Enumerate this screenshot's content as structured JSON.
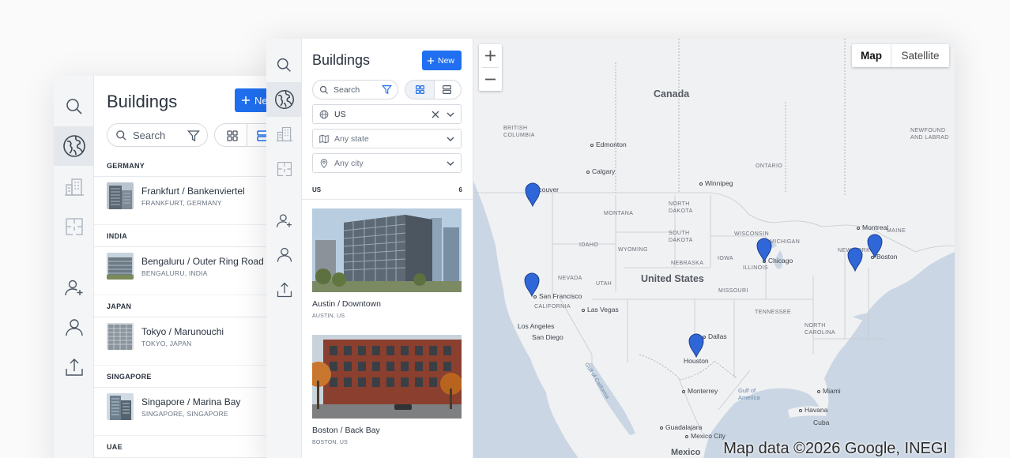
{
  "colors": {
    "accent": "#1f6ff0",
    "marker": "#2f66d8",
    "land": "#f0f1f3",
    "water": "#cad6e3"
  },
  "back_window": {
    "title": "Buildings",
    "new_label": "Ne",
    "search_placeholder": "Search",
    "groups": [
      {
        "name": "GERMANY",
        "items": [
          {
            "name": "Frankfurt / Bankenviertel",
            "location": "FRANKFURT, GERMANY"
          }
        ]
      },
      {
        "name": "INDIA",
        "items": [
          {
            "name": "Bengaluru / Outer Ring Road",
            "location": "BENGALURU, INDIA"
          }
        ]
      },
      {
        "name": "JAPAN",
        "items": [
          {
            "name": "Tokyo / Marunouchi",
            "location": "TOKYO, JAPAN"
          }
        ]
      },
      {
        "name": "SINGAPORE",
        "items": [
          {
            "name": "Singapore / Marina Bay",
            "location": "SINGAPORE, SINGAPORE"
          }
        ]
      },
      {
        "name": "UAE",
        "items": []
      }
    ]
  },
  "front_window": {
    "title": "Buildings",
    "new_label": "New",
    "search_placeholder": "Search",
    "country_filter": "US",
    "state_placeholder": "Any state",
    "city_placeholder": "Any city",
    "group": {
      "name": "US",
      "count": "6"
    },
    "cards": [
      {
        "name": "Austin / Downtown",
        "location": "AUSTIN, US"
      },
      {
        "name": "Boston / Back Bay",
        "location": "BOSTON, US"
      }
    ]
  },
  "map": {
    "type_map": "Map",
    "type_satellite": "Satellite",
    "attribution": "Map data ©2026 Google, INEGI",
    "labels": {
      "canada": "Canada",
      "united_states": "United States",
      "mexico": "Mexico",
      "british_columbia": "BRITISH\nCOLUMBIA",
      "ontario": "ONTARIO",
      "newfoundland": "NEWFOUND\nAND LABRAD",
      "montana": "MONTANA",
      "north_dakota": "NORTH\nDAKOTA",
      "south_dakota": "SOUTH\nDAKOTA",
      "wyoming": "WYOMING",
      "idaho": "IDAHO",
      "nebraska": "NEBRASKA",
      "nevada": "NEVADA",
      "utah": "UTAH",
      "california": "CALIFORNIA",
      "iowa": "IOWA",
      "illinois": "ILLINOIS",
      "wisconsin": "WISCONSIN",
      "michigan": "MICHIGAN",
      "missouri": "MISSOURI",
      "tennessee": "TENNESSEE",
      "new_york": "NEW YORK",
      "maine": "MAINE",
      "north_carolina": "NORTH\nCAROLINA",
      "gulf_of_mexico": "Gulf of\nAmerica",
      "gulf_of_california": "Gulf of California",
      "cuba": "Cuba",
      "edmonton": "Edmonton",
      "calgary": "Calgary",
      "winnipeg": "Winnipeg",
      "vancouver": "Vancouver",
      "montreal": "Montreal",
      "boston": "Boston",
      "chicago": "Chicago",
      "san_francisco": "San Francisco",
      "las_vegas": "Las Vegas",
      "los_angeles": "Los Angeles",
      "san_diego": "San Diego",
      "dallas": "Dallas",
      "houston": "Houston",
      "monterrey": "Monterrey",
      "miami": "Miami",
      "havana": "Havana",
      "guadalajara": "Guadalajara",
      "mexico_city": "Mexico City"
    }
  }
}
